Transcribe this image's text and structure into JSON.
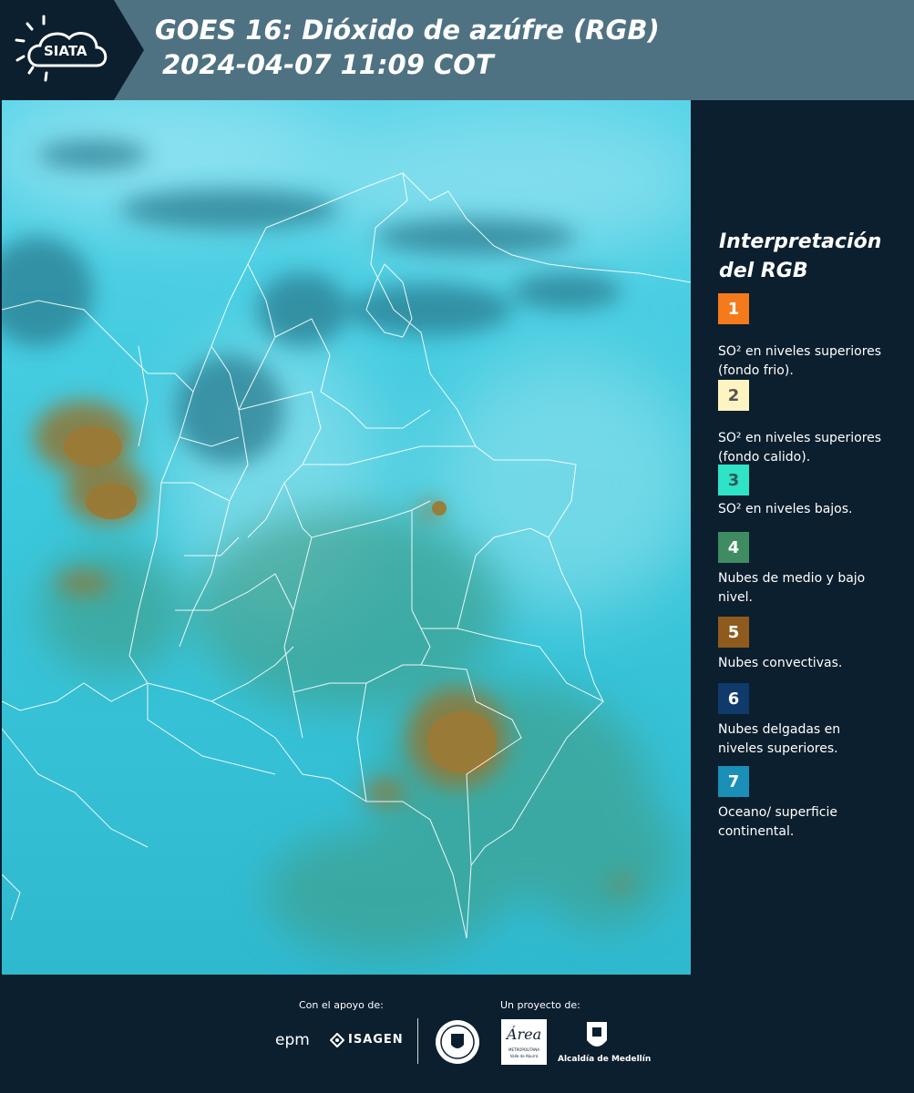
{
  "header": {
    "logo_text": "SIATA",
    "title": "GOES 16: Dióxido de azúfre (RGB)",
    "subtitle": "2024-04-07 11:09 COT"
  },
  "legend": {
    "title": "Interpretación del RGB",
    "items": [
      {
        "number": "1",
        "color": "#f47a1b",
        "text_color": "#ffffff",
        "text": "SO² en niveles superiores (fondo frio)."
      },
      {
        "number": "2",
        "color": "#fef4c2",
        "text_color": "#555555",
        "text": "SO² en niveles superiores (fondo calido)."
      },
      {
        "number": "3",
        "color": "#2fe3c6",
        "text_color": "#2a5a5a",
        "text": "SO² en niveles bajos."
      },
      {
        "number": "4",
        "color": "#3f8c63",
        "text_color": "#ffffff",
        "text": "Nubes de medio y bajo nivel."
      },
      {
        "number": "5",
        "color": "#8f5b1c",
        "text_color": "#ffffff",
        "text": "Nubes convectivas."
      },
      {
        "number": "6",
        "color": "#0f3a6b",
        "text_color": "#ffffff",
        "text": "Nubes delgadas en niveles superiores."
      },
      {
        "number": "7",
        "color": "#1a8fb8",
        "text_color": "#ffffff",
        "text": "Oceano/ superficie continental."
      }
    ]
  },
  "footer": {
    "support_label": "Con el apoyo de:",
    "project_label": "Un proyecto de:",
    "sponsors": [
      "epm",
      "ISAGEN"
    ],
    "partners": [
      "Área Metropolitana Valle de Aburrá",
      "Alcaldía de Medellín"
    ],
    "partner_texts": {
      "area_main": "Área",
      "area_sub1": "METROPOLITANA",
      "area_sub2": "Valle de Aburrá",
      "alcaldia": "Alcaldía de Medellín"
    }
  },
  "colors": {
    "header": "#4f7283",
    "header_dark": "#0c1f2e",
    "background": "#0c1f2e",
    "map_base": "#3ac9dc",
    "cloud_dark": "#2f7f92",
    "convective": "#8f7a3a"
  }
}
